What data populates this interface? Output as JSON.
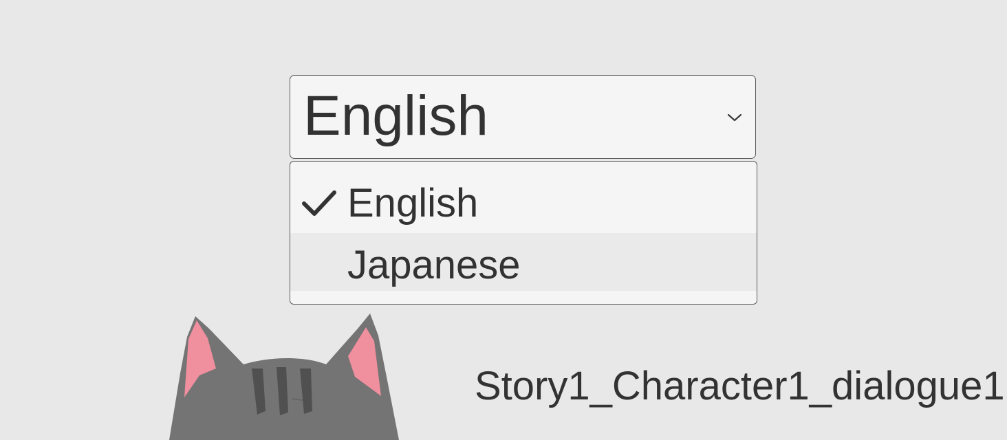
{
  "language_dropdown": {
    "selected_value": "English",
    "arrow_icon": "chevron-down-icon",
    "options": [
      {
        "label": "English",
        "selected": true,
        "icon": "check-icon"
      },
      {
        "label": "Japanese",
        "selected": false
      }
    ]
  },
  "character": {
    "image": "gray-cat-illustration"
  },
  "dialogue": {
    "text": "Story1_Character1_dialogue1"
  },
  "colors": {
    "background": "#e8e8e8",
    "panel": "#f5f5f5",
    "hover_option": "#eaeaea",
    "text": "#323232",
    "border": "#5a5a5a"
  }
}
